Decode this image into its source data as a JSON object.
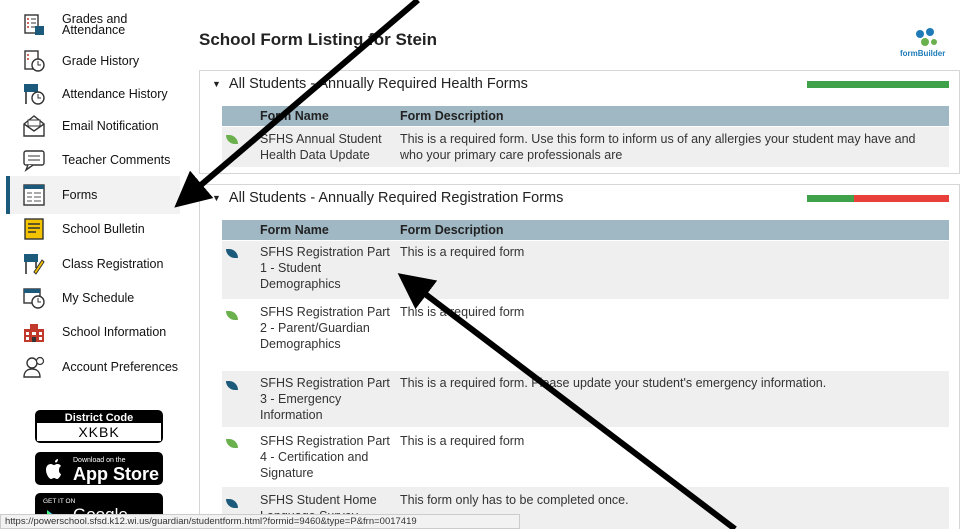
{
  "top_fragment": "p",
  "sidebar": {
    "items": [
      {
        "label": "Grades and Attendance",
        "icon": "grades-attendance-icon"
      },
      {
        "label": "Grade History",
        "icon": "grade-history-icon"
      },
      {
        "label": "Attendance History",
        "icon": "attendance-history-icon"
      },
      {
        "label": "Email Notification",
        "icon": "email-icon"
      },
      {
        "label": "Teacher Comments",
        "icon": "comments-icon"
      },
      {
        "label": "Forms",
        "icon": "forms-icon",
        "active": true
      },
      {
        "label": "School Bulletin",
        "icon": "bulletin-icon"
      },
      {
        "label": "Class Registration",
        "icon": "class-registration-icon"
      },
      {
        "label": "My Schedule",
        "icon": "schedule-icon"
      },
      {
        "label": "School Information",
        "icon": "school-icon"
      },
      {
        "label": "Account Preferences",
        "icon": "account-preferences-icon"
      }
    ],
    "district_code_label": "District Code",
    "district_code_value": "XKBK",
    "app_store_small": "Download on the",
    "app_store_big": "App Store",
    "google_play_small": "GET IT ON",
    "google_play_big": "Google play"
  },
  "header": {
    "title": "School Form Listing for Stein",
    "logo_text": "formBuilder"
  },
  "sections": [
    {
      "title": "All Students - Annually Required Health Forms",
      "progress": {
        "complete_fraction": 1.0,
        "colors": {
          "complete": "#3fa24a",
          "incomplete": "#e84038"
        }
      },
      "columns": [
        "Form Name",
        "Form Description"
      ],
      "rows": [
        {
          "name": "SFHS Annual Student Health Data Update",
          "description": "This is a required form. Use this form to inform us of any allergies your student may have and who your primary care professionals are",
          "status": "green"
        }
      ]
    },
    {
      "title": "All Students - Annually Required Registration Forms",
      "progress": {
        "complete_fraction": 0.33,
        "colors": {
          "complete": "#3fa24a",
          "incomplete": "#e84038"
        }
      },
      "columns": [
        "Form Name",
        "Form Description"
      ],
      "rows": [
        {
          "name": "SFHS Registration Part 1 - Student Demographics",
          "description": "This is a required form",
          "status": "blue"
        },
        {
          "name": "SFHS Registration Part 2 - Parent/Guardian Demographics",
          "description": "This is a required form",
          "status": "green"
        },
        {
          "name": "SFHS Registration Part 3 - Emergency Information",
          "description": "This is a required form. Please update your student's emergency information.",
          "status": "blue"
        },
        {
          "name": "SFHS Registration Part 4 - Certification and Signature",
          "description": "This is a required form",
          "status": "green"
        },
        {
          "name": "SFHS Student Home Language Survey",
          "description": "This form only has to be completed once.",
          "status": "blue"
        }
      ]
    }
  ],
  "status_bar": "https://powerschool.sfsd.k12.wi.us/guardian/studentform.html?formid=9460&type=P&frn=0017419",
  "colors": {
    "leaf_green": "#6ab04c",
    "leaf_blue": "#1b5a7a",
    "header_row": "#9fb8c4"
  }
}
